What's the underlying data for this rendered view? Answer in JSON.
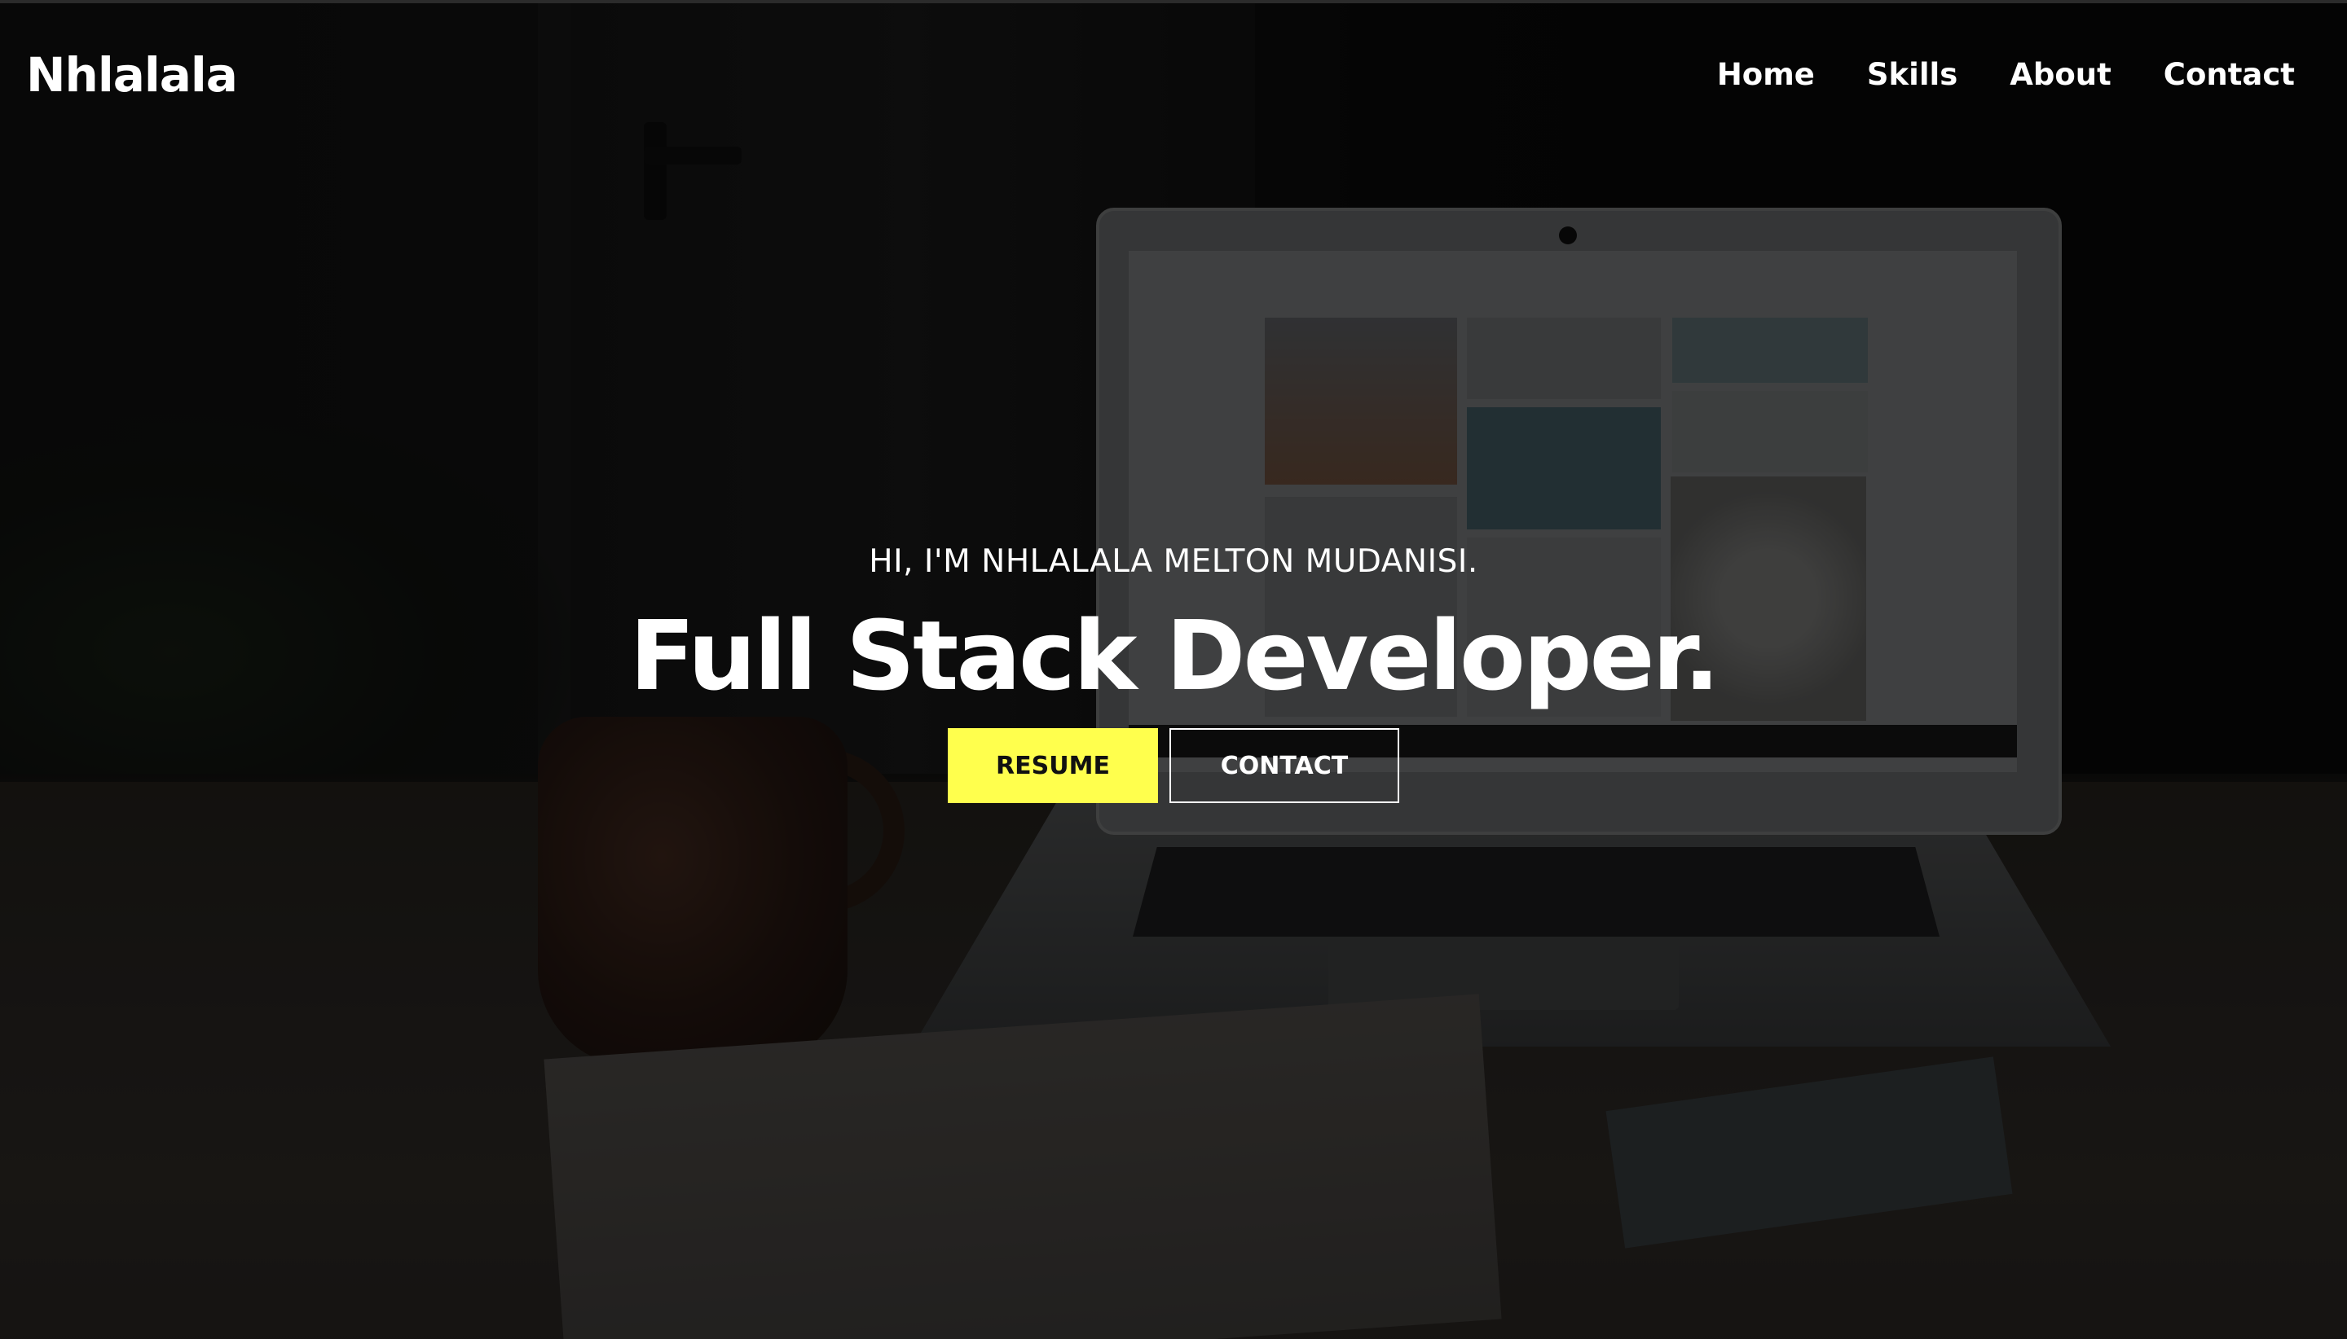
{
  "header": {
    "brand": "Nhlalala",
    "nav": [
      {
        "label": "Home"
      },
      {
        "label": "Skills"
      },
      {
        "label": "About"
      },
      {
        "label": "Contact"
      }
    ]
  },
  "hero": {
    "intro": "HI, I'M NHLALALA MELTON MUDANISI.",
    "headline": "Full Stack Developer.",
    "resume_button": "RESUME",
    "contact_button": "CONTACT"
  },
  "colors": {
    "accent": "#ffff4d",
    "overlay": "#000000",
    "text": "#ffffff"
  }
}
